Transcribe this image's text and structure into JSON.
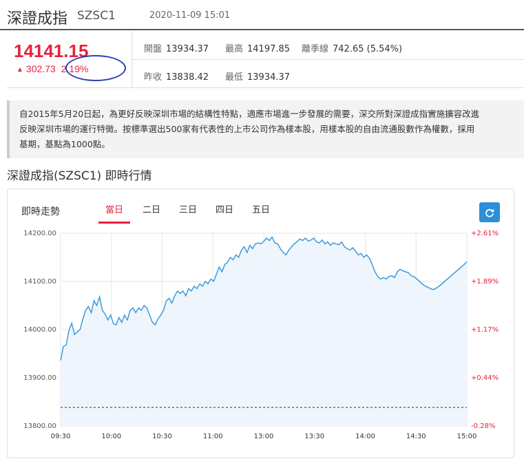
{
  "header": {
    "name": "深證成指",
    "code": "SZSC1",
    "time": "2020-11-09 15:01"
  },
  "quote": {
    "price": "14141.15",
    "change": "302.73",
    "change_pct": "2.19%",
    "stats": [
      {
        "label": "開盤",
        "value": "13934.37"
      },
      {
        "label": "最高",
        "value": "14197.85"
      },
      {
        "label": "離季線",
        "value": "742.65 (5.54%)"
      },
      {
        "label": "昨收",
        "value": "13838.42"
      },
      {
        "label": "最低",
        "value": "13934.37"
      }
    ]
  },
  "description": [
    "自2015年5月20日起，為更好反映深圳市場的結構性特點，適應市場進一步發展的需要，深交所對深證成指實施擴容改進",
    "反映深圳市場的運行特徵。按標準選出500家有代表性的上市公司作為樣本股，用樣本股的自由流通股數作為權數，採用",
    "基期，基點為1000點。"
  ],
  "section_title": "深證成指(SZSC1) 即時行情",
  "chart_card": {
    "title": "即時走勢",
    "tabs": [
      "當日",
      "二日",
      "三日",
      "四日",
      "五日"
    ],
    "active_tab": 0,
    "refresh_icon": "refresh-icon"
  },
  "colors": {
    "up": "#e8203a",
    "line": "#3d9bdc",
    "area": "#eef5fc",
    "accent": "#2d8fd5",
    "annotation": "#2f3bb5"
  },
  "chart_data": {
    "type": "area",
    "xlabel": "",
    "ylabel": "",
    "ylim": [
      13800,
      14200
    ],
    "yticks": [
      13800,
      13900,
      14000,
      14100,
      14200
    ],
    "ytick_labels": [
      "13800.00",
      "13900.00",
      "14000.00",
      "14100.00",
      "14200.00"
    ],
    "right_tick_labels": [
      "-0.28%",
      "+0.44%",
      "+1.17%",
      "+1.89%",
      "+2.61%"
    ],
    "xtick_labels": [
      "09:30",
      "10:00",
      "10:30",
      "11:00",
      "13:00",
      "13:30",
      "14:00",
      "14:30",
      "15:00"
    ],
    "prev_close": 13838.42,
    "grid": true,
    "series": [
      {
        "values": [
          13936,
          13965,
          13968,
          13998,
          14013,
          13990,
          13995,
          14000,
          14022,
          14040,
          14048,
          14035,
          14060,
          14050,
          14068,
          14040,
          14032,
          14020,
          14030,
          14012,
          14010,
          14025,
          14015,
          14030,
          14020,
          14040,
          14045,
          14035,
          14045,
          14040,
          14050,
          14045,
          14030,
          14015,
          14010,
          14022,
          14030,
          14040,
          14060,
          14065,
          14055,
          14070,
          14080,
          14075,
          14080,
          14070,
          14085,
          14080,
          14090,
          14085,
          14095,
          14090,
          14100,
          14095,
          14105,
          14100,
          14115,
          14130,
          14120,
          14135,
          14140,
          14150,
          14145,
          14155,
          14150,
          14165,
          14172,
          14160,
          14175,
          14168,
          14178,
          14180,
          14178,
          14183,
          14190,
          14185,
          14192,
          14180,
          14178,
          14168,
          14160,
          14155,
          14165,
          14172,
          14178,
          14183,
          14188,
          14185,
          14190,
          14184,
          14186,
          14190,
          14182,
          14180,
          14186,
          14178,
          14182,
          14175,
          14180,
          14178,
          14176,
          14182,
          14172,
          14168,
          14165,
          14170,
          14163,
          14155,
          14158,
          14150,
          14155,
          14148,
          14135,
          14120,
          14110,
          14105,
          14108,
          14105,
          14110,
          14112,
          14108,
          14120,
          14125,
          14122,
          14120,
          14118,
          14112,
          14110,
          14105,
          14100,
          14095,
          14090,
          14088,
          14085,
          14083,
          14086,
          14090,
          14095,
          14100,
          14105,
          14110,
          14115,
          14120,
          14125,
          14130,
          14135,
          14141
        ]
      }
    ]
  }
}
